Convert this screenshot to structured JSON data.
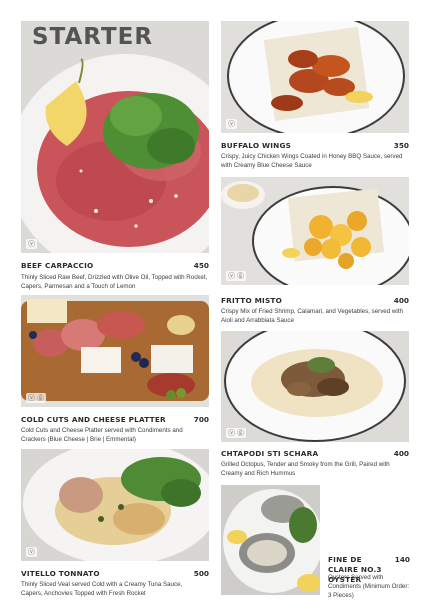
{
  "page": {
    "title": "STARTER"
  },
  "diet_badges": {
    "standard": "ⓥ",
    "double": "ⓥ ⓖ"
  },
  "items": [
    {
      "name": "BEEF CARPACCIO",
      "price": "450",
      "description": "Thinly Sliced Raw Beef, Drizzled with Olive Oil, Topped with Rocket, Capers, Parmesan and a Touch of Lemon"
    },
    {
      "name": "BUFFALO WINGS",
      "price": "350",
      "description": "Crispy, Juicy Chicken Wings Coated in Honey BBQ Sauce, served with Creamy Blue Cheese Sauce"
    },
    {
      "name": "FRITTO MISTO",
      "price": "400",
      "description": "Crispy Mix of Fried Shrimp, Calamari, and Vegetables, served with Aioli and Arrabbiata Sauce"
    },
    {
      "name": "COLD CUTS AND CHEESE PLATTER",
      "price": "700",
      "description": "Cold Cuts and Cheese Platter served with Condiments and Crackers (Blue Cheese | Brie | Emmental)"
    },
    {
      "name": "CHTAPODI STI SCHARA",
      "price": "400",
      "description": "Grilled Octopus, Tender and Smoky from the Grill, Paired with Creamy and Rich Hummus"
    },
    {
      "name": "VITELLO TONNATO",
      "price": "500",
      "description": "Thinly Sliced Veal served Cold with a Creamy Tuna Sauce, Capers, Anchovies Topped with Fresh Rocket"
    },
    {
      "name": "FINE DE CLAIRE NO.3 OYSTER",
      "price": "140",
      "description": "Oysters Served with Condiments (Minimum Order: 3 Pieces)"
    }
  ]
}
